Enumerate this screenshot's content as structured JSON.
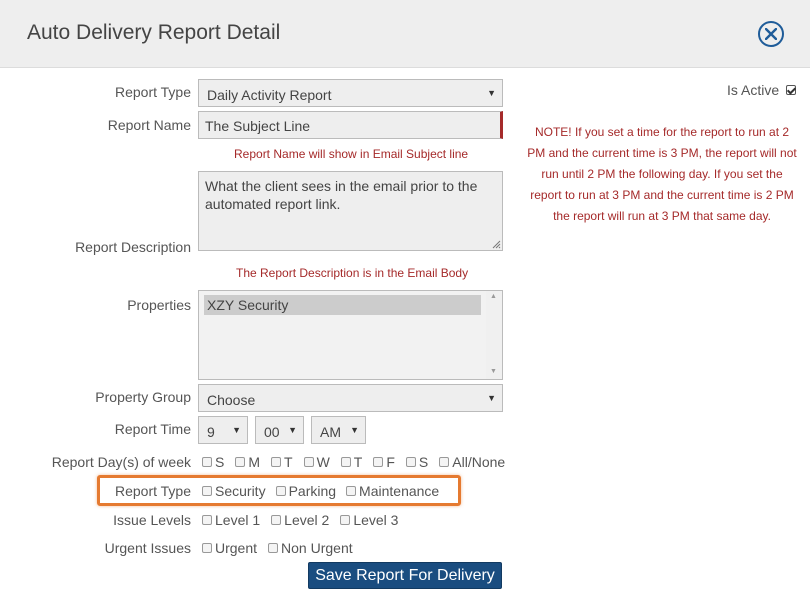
{
  "header": {
    "title": "Auto Delivery Report Detail",
    "close_icon": "close-icon"
  },
  "is_active": {
    "label": "Is Active",
    "checked": true
  },
  "note": "NOTE! If you set a time for the report to run at 2 PM and the current time is 3 PM, the report will not run until 2 PM the following day. If you set the report to run at 3 PM and the current time is 2 PM the report will run at 3 PM that same day.",
  "form": {
    "report_type": {
      "label": "Report Type",
      "value": "Daily Activity Report"
    },
    "report_name": {
      "label": "Report Name",
      "value": "The Subject Line",
      "hint": "Report Name will show in Email Subject line"
    },
    "report_description": {
      "label": "Report Description",
      "value": "What the client sees in the email prior to the automated report link.",
      "hint": "The Report Description is in the Email Body"
    },
    "properties": {
      "label": "Properties",
      "items": [
        "XZY Security"
      ]
    },
    "property_group": {
      "label": "Property Group",
      "value": "Choose"
    },
    "report_time": {
      "label": "Report Time",
      "hour": "9",
      "minute": "00",
      "ampm": "AM"
    },
    "report_days": {
      "label": "Report Day(s) of week",
      "options": [
        "S",
        "M",
        "T",
        "W",
        "T",
        "F",
        "S",
        "All/None"
      ]
    },
    "report_type_filter": {
      "label": "Report Type",
      "options": [
        "Security",
        "Parking",
        "Maintenance"
      ]
    },
    "issue_levels": {
      "label": "Issue Levels",
      "options": [
        "Level 1",
        "Level 2",
        "Level 3"
      ]
    },
    "urgent_issues": {
      "label": "Urgent Issues",
      "options": [
        "Urgent",
        "Non Urgent"
      ]
    }
  },
  "save_button": "Save Report For Delivery",
  "colors": {
    "header_bg": "#eeeeee",
    "accent": "#1a4d80",
    "hint_red": "#a52a2a",
    "highlight": "#e57a30"
  }
}
